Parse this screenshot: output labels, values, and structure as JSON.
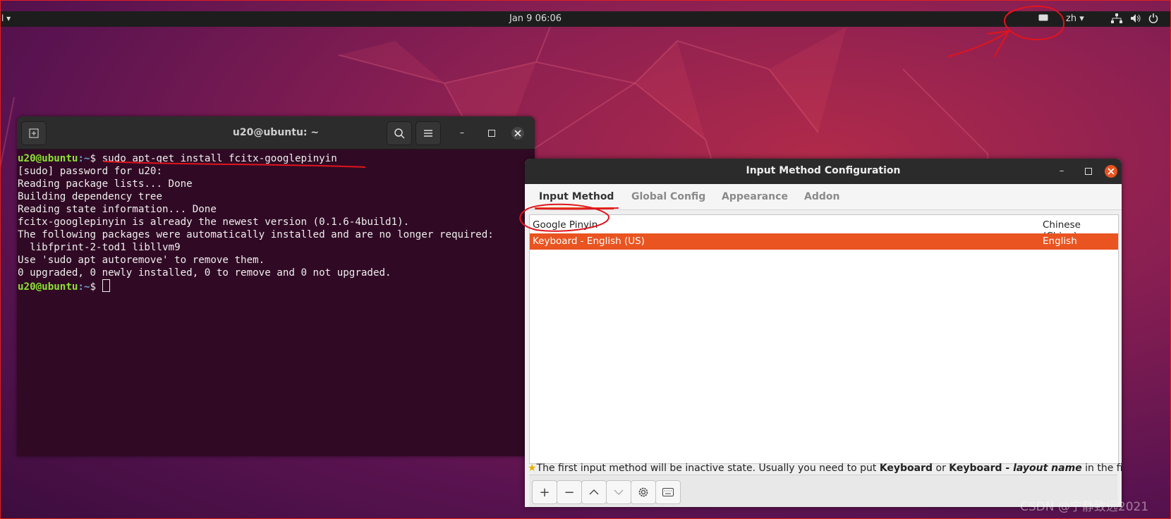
{
  "topbar": {
    "activities": "l",
    "clock": "Jan 9  06:06",
    "input_lang": "zh"
  },
  "terminal": {
    "title": "u20@ubuntu: ~",
    "prompt_user": "u20@ubuntu",
    "prompt_path": ":~",
    "prompt_symbol": "$ ",
    "command": "sudo apt-get install fcitx-googlepinyin",
    "output": [
      "[sudo] password for u20:",
      "Reading package lists... Done",
      "Building dependency tree",
      "Reading state information... Done",
      "fcitx-googlepinyin is already the newest version (0.1.6-4build1).",
      "The following packages were automatically installed and are no longer required:",
      "  libfprint-2-tod1 libllvm9",
      "Use 'sudo apt autoremove' to remove them.",
      "0 upgraded, 0 newly installed, 0 to remove and 0 not upgraded."
    ]
  },
  "imconfig": {
    "title": "Input Method Configuration",
    "tabs": [
      "Input Method",
      "Global Config",
      "Appearance",
      "Addon"
    ],
    "rows": [
      {
        "name": "Google Pinyin",
        "lang": "Chinese (China)"
      },
      {
        "name": "Keyboard - English (US)",
        "lang": "English"
      }
    ],
    "hint": {
      "a": "The first input method will be inactive state. Usually you need to put ",
      "b": "Keyboard",
      "c": " or ",
      "d": "Keyboard - ",
      "e": "layout name",
      "f": " in the first place."
    }
  },
  "watermark": "CSDN @宁静致远2021",
  "colors": {
    "accent": "#e95420",
    "terminal_bg": "#300a24",
    "annotation": "#e0141e"
  }
}
